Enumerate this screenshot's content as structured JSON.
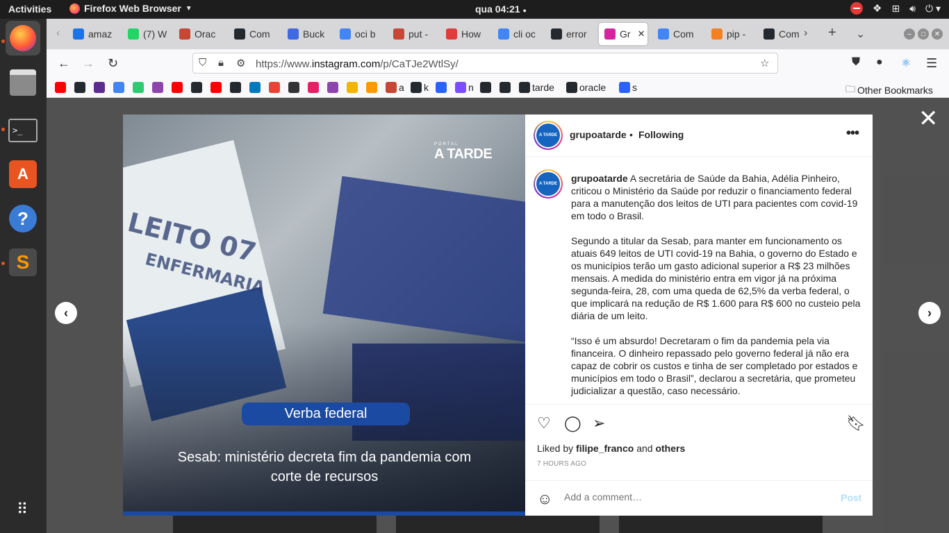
{
  "topbar": {
    "activities": "Activities",
    "app_name": "Firefox Web Browser",
    "clock": "qua 04:21"
  },
  "dock": {
    "items": [
      "firefox",
      "files",
      "terminal",
      "software",
      "help",
      "sublime-text",
      "app-grid"
    ]
  },
  "tabs": [
    {
      "label": "amaz",
      "color": "#1a73e8"
    },
    {
      "label": "(7) W",
      "color": "#25d366"
    },
    {
      "label": "Orac",
      "color": "#c74634"
    },
    {
      "label": "Com",
      "color": "#24292f"
    },
    {
      "label": "Buck",
      "color": "#4169e1"
    },
    {
      "label": "oci b",
      "color": "#4285f4"
    },
    {
      "label": "put -",
      "color": "#c74634"
    },
    {
      "label": "How",
      "color": "#e03c3c"
    },
    {
      "label": "cli oc",
      "color": "#4285f4"
    },
    {
      "label": "error",
      "color": "#24292f"
    },
    {
      "label": "Gr",
      "color": "#d6249f",
      "active": true
    },
    {
      "label": "Com",
      "color": "#4285f4"
    },
    {
      "label": "pip -",
      "color": "#f48024"
    },
    {
      "label": "Com",
      "color": "#24292f"
    }
  ],
  "navbar": {
    "url_prefix": "https://www.",
    "url_domain": "instagram.com",
    "url_path": "/p/CaTJe2WtlSy/"
  },
  "bookmarks": {
    "items": [
      {
        "label": "",
        "color": "#ff0000"
      },
      {
        "label": "",
        "color": "#24292f"
      },
      {
        "label": "",
        "color": "#5c2d91"
      },
      {
        "label": "",
        "color": "#4285f4"
      },
      {
        "label": "",
        "color": "#2ecc71"
      },
      {
        "label": "",
        "color": "#8e44ad"
      },
      {
        "label": "",
        "color": "#ff0000"
      },
      {
        "label": "",
        "color": "#24292f"
      },
      {
        "label": "",
        "color": "#ff0000"
      },
      {
        "label": "",
        "color": "#24292f"
      },
      {
        "label": "",
        "color": "#0079bf"
      },
      {
        "label": "",
        "color": "#ea4335"
      },
      {
        "label": "",
        "color": "#333333"
      },
      {
        "label": "",
        "color": "#e91e63"
      },
      {
        "label": "",
        "color": "#8e44ad"
      },
      {
        "label": "",
        "color": "#f4b400"
      },
      {
        "label": "",
        "color": "#ff9900"
      },
      {
        "label": "a",
        "color": "#c74634"
      },
      {
        "label": "k",
        "color": "#24292f"
      },
      {
        "label": "",
        "color": "#2962ff"
      },
      {
        "label": "n",
        "color": "#7c4dff"
      },
      {
        "label": "",
        "color": "#24292f"
      },
      {
        "label": "",
        "color": "#24292f"
      },
      {
        "label": "tarde",
        "color": "#24292f"
      },
      {
        "label": "oracle",
        "color": "#24292f"
      },
      {
        "label": "s",
        "color": "#2962ff"
      }
    ],
    "other": "Other Bookmarks"
  },
  "post": {
    "watermark_small": "PORTAL",
    "watermark": "A TARDE",
    "sign_line1": "LEITO 07",
    "sign_line2": "ENFERMARIA",
    "pill": "Verba federal",
    "image_caption": "Sesab: ministério decreta fim da pandemia com corte de recursos",
    "username": "grupoatarde",
    "separator": "•",
    "following": "Following",
    "avatar_logo": "A TARDE",
    "caption_username": "grupoatarde",
    "caption_p1": "A secretária de Saúde da Bahia, Adélia Pinheiro, criticou o Ministério da Saúde por reduzir o financiamento federal para a manutenção dos leitos de UTI para pacientes com covid-19 em todo o Brasil.",
    "caption_p2": "Segundo a titular da Sesab, para manter em funcionamento os atuais 649 leitos de UTI covid-19 na Bahia, o governo do Estado e os municípios terão um gasto adicional superior a R$ 23 milhões mensais. A medida do ministério entra em vigor já na próxima segunda-feira, 28, com uma queda de 62,5% da verba federal, o que implicará na redução de R$ 1.600 para R$ 600 no custeio pela diária de um leito.",
    "caption_p3": "“Isso é um absurdo! Decretaram o fim da pandemia pela via financeira. O dinheiro repassado pelo governo federal já não era capaz de cobrir os custos e tinha de ser completado por estados e municípios em todo o Brasil”, declarou a secretária, que prometeu judicializar a questão, caso necessário.",
    "liked_by_prefix": "Liked by",
    "liked_by_user": "filipe_franco",
    "liked_by_and": "and",
    "liked_by_others": "others",
    "timestamp": "7 HOURS AGO",
    "comment_placeholder": "Add a comment…",
    "post_button": "Post"
  }
}
